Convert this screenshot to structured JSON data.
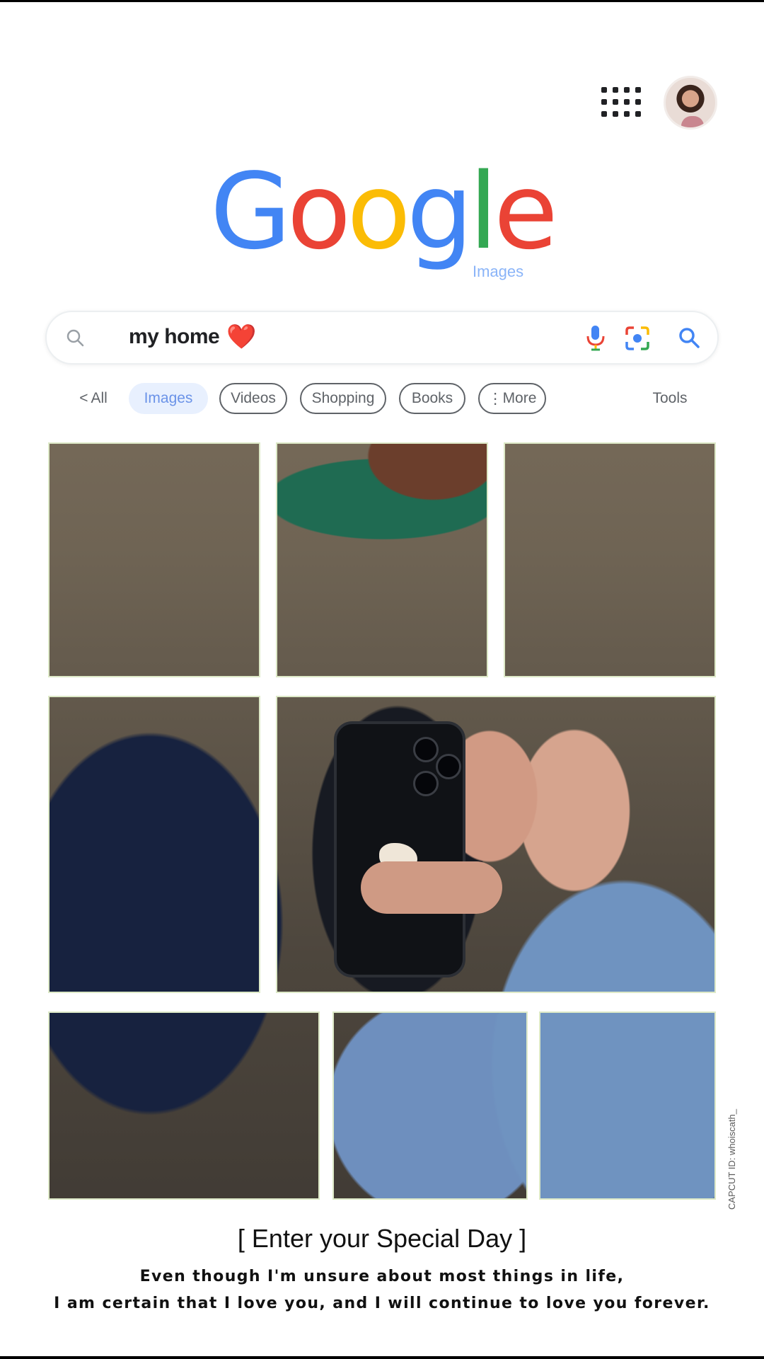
{
  "header": {
    "apps_icon": "apps-grid-icon",
    "avatar_icon": "profile-avatar"
  },
  "logo": {
    "letters": [
      {
        "char": "G",
        "color": "#4285F4"
      },
      {
        "char": "o",
        "color": "#EA4335"
      },
      {
        "char": "o",
        "color": "#FBBC05"
      },
      {
        "char": "g",
        "color": "#4285F4"
      },
      {
        "char": "l",
        "color": "#34A853"
      },
      {
        "char": "e",
        "color": "#EA4335"
      }
    ],
    "sub": "Images"
  },
  "search": {
    "query": "my home",
    "emoji": "❤️",
    "left_icon": "search-icon",
    "icons": [
      "mic-icon",
      "lens-icon",
      "search-icon"
    ]
  },
  "tabs": {
    "all": "All",
    "images": "Images",
    "videos": "Videos",
    "shopping": "Shopping",
    "books": "Books",
    "more": "More",
    "tools": "Tools"
  },
  "caption": {
    "title": "[ Enter your Special Day ]",
    "line1": "Even though I'm unsure about most things in life,",
    "line2": "I am certain that I love you, and I will continue to love you forever."
  },
  "watermark": "CAPCUT ID: whoiscath_",
  "colors": {
    "accent_blue": "#4285F4",
    "images_tab_bg": "#e8f0fe",
    "heart_red": "#e0161c"
  }
}
